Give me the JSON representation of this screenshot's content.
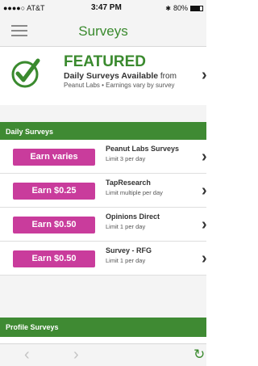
{
  "status_bar": {
    "carrier": "●●●●○ AT&T",
    "time": "3:47 PM",
    "battery": "80%",
    "battery_level": 0.8
  },
  "nav": {
    "title": "Surveys",
    "menu_icon": "hamburger-icon"
  },
  "featured": {
    "badge_icon": "check-circle-icon",
    "title": "FEATURED",
    "line1_bold": "Daily Surveys Available",
    "line1_rest": " from",
    "line2": "Peanut Labs • Earnings vary by survey"
  },
  "daily": {
    "header": "Daily Surveys",
    "rows": [
      {
        "earn": "Earn varies",
        "title": "Peanut Labs Surveys",
        "limit": "Limit 3 per day"
      },
      {
        "earn": "Earn $0.25",
        "title": "TapResearch",
        "limit": "Limit multiple per day"
      },
      {
        "earn": "Earn $0.50",
        "title": "Opinions Direct",
        "limit": "Limit 1 per day"
      },
      {
        "earn": "Earn $0.50",
        "title": "Survey - RFG",
        "limit": "Limit 1 per day"
      }
    ]
  },
  "profile": {
    "header": "Profile Surveys"
  },
  "toolbar": {
    "back_icon": "chevron-left-icon",
    "forward_icon": "chevron-right-icon",
    "refresh_icon": "refresh-icon",
    "accent": "#3a8a2e",
    "earn_color": "#c93c9c"
  }
}
